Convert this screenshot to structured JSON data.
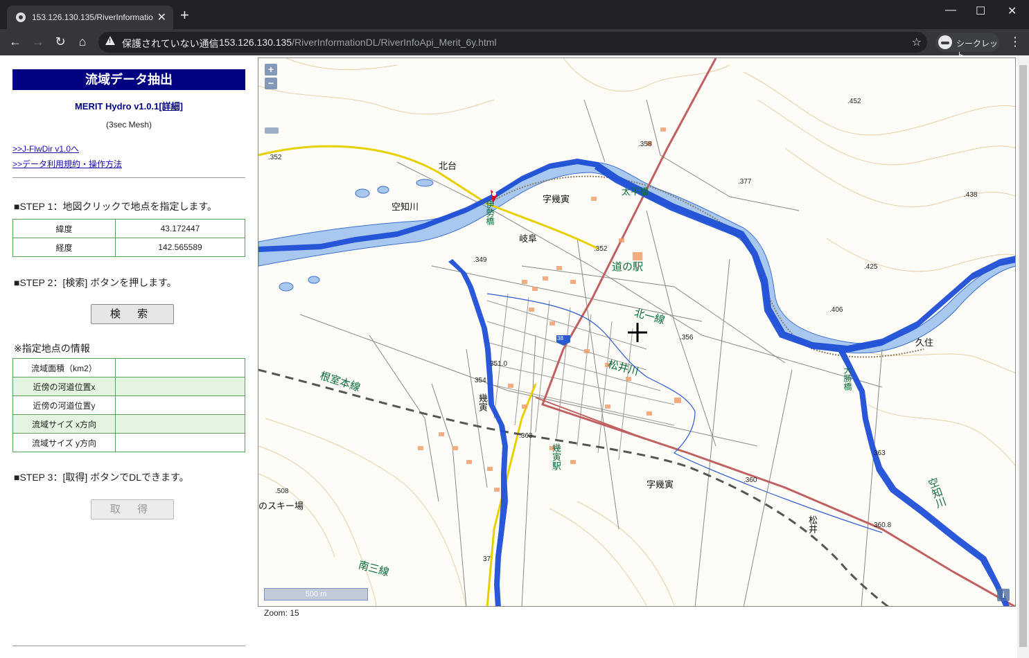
{
  "browser": {
    "tab_title": "153.126.130.135/RiverInformatio",
    "tab_close": "✕",
    "new_tab": "+",
    "window_controls": {
      "minimize": "—",
      "maximize": "☐",
      "close": "✕"
    },
    "nav": {
      "back": "←",
      "forward": "→",
      "reload": "↻",
      "home": "⌂"
    },
    "security_label": "保護されていない通信",
    "url_host": "153.126.130.135",
    "url_path": "/RiverInformationDL/RiverInfoApi_Merit_6y.html",
    "bookmark": "☆",
    "incognito_label": "シークレット",
    "menu": "⋮"
  },
  "sidebar": {
    "title": "流域データ抽出",
    "merit_label": "MERIT Hydro v1.0.1",
    "merit_link": "[詳細]",
    "mesh": "(3sec Mesh)",
    "link_jflwdir": ">>J-FlwDir v1.0へ",
    "link_terms": ">>データ利用規約・操作方法",
    "step1": "■STEP 1：地図クリックで地点を指定します。",
    "coords": [
      {
        "label": "緯度",
        "value": "43.172447"
      },
      {
        "label": "経度",
        "value": "142.565589"
      }
    ],
    "step2": "■STEP 2：[検索] ボタンを押します。",
    "search_button": "検 索",
    "info_heading": "※指定地点の情報",
    "info_rows": [
      {
        "label": "流域面積（km2）",
        "value": ""
      },
      {
        "label": "近傍の河道位置x",
        "value": ""
      },
      {
        "label": "近傍の河道位置y",
        "value": ""
      },
      {
        "label": "流域サイズ x方向",
        "value": ""
      },
      {
        "label": "流域サイズ y方向",
        "value": ""
      }
    ],
    "step3": "■STEP 3：[取得] ボタンでDLできます。",
    "get_button": "取 得"
  },
  "map": {
    "zoom_in": "+",
    "zoom_out": "−",
    "scale_label": "500 m",
    "info_button": "i",
    "zoom_readout": "Zoom: 15",
    "labels": {
      "kitadai": "北台",
      "sorachi_river": "空知川",
      "azaikutora_n": "字幾寅",
      "gifu": "岐阜",
      "michi_no_eki": "道の駅",
      "taihei_bridge": "太平橋",
      "kita_ichisen": "北一線",
      "matsui_river": "松井川",
      "nemuro_line": "根室本線",
      "ikutora": "幾寅",
      "ikutora_station": "幾寅駅",
      "azaikutora_s": "字幾寅",
      "ski": "のスキー場",
      "minami_sansen": "南三線",
      "matsui": "松井",
      "kuzumi": "久住",
      "sorachi_river_e": "空知川",
      "ise_bridge": "伊勢橋",
      "taisho_bridge": "大勝橋"
    },
    "elevations": [
      ".352",
      ".358",
      ".377",
      ".452",
      ".438",
      ".425",
      ".406",
      ".352",
      ".349",
      ".356",
      ".363",
      ".360",
      "360.8",
      "363",
      ".508",
      "354",
      "351.0",
      "37"
    ],
    "route_shield": "38",
    "colors": {
      "watershed_cell": "#1f4fd6",
      "river_fill": "#a8c8f0",
      "rail": "#c05050",
      "road": "#e6d000"
    }
  }
}
